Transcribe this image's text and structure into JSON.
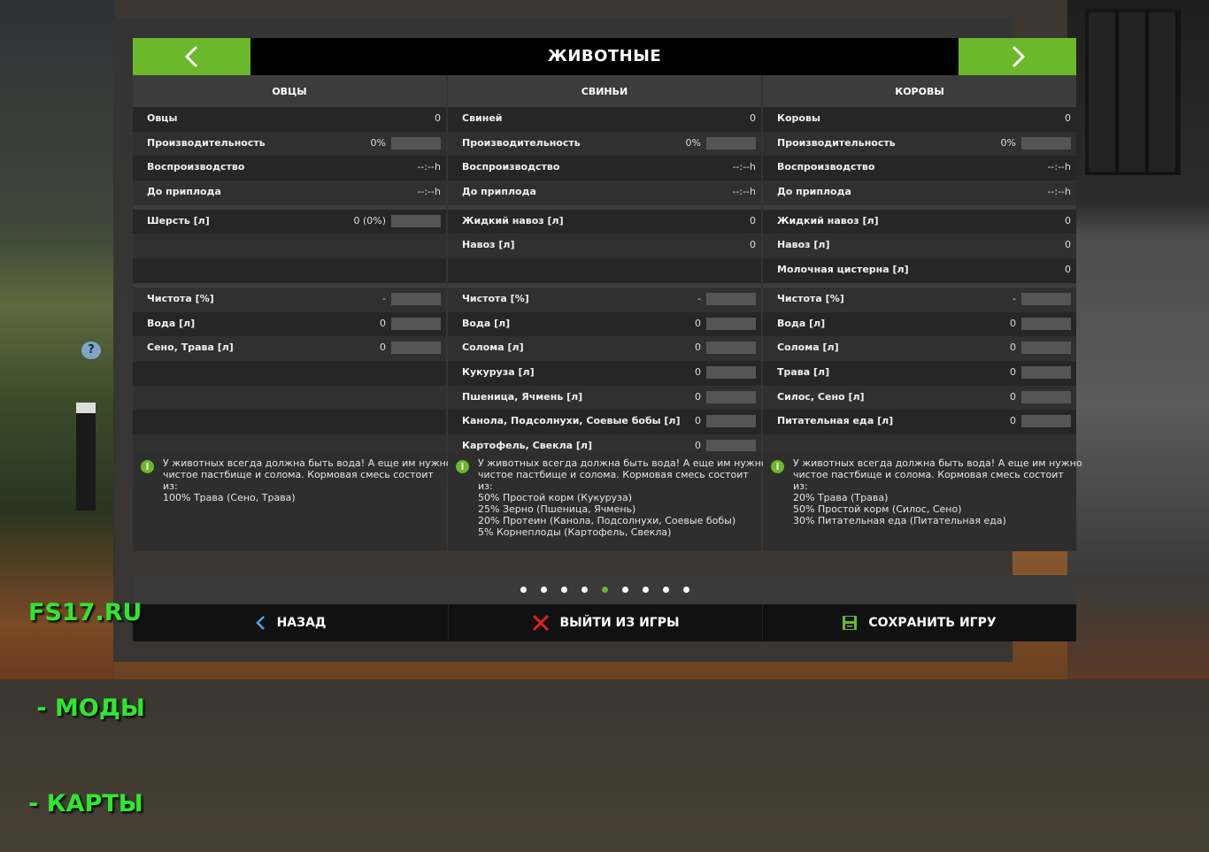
{
  "header": {
    "title": "ЖИВОТНЫЕ"
  },
  "columns": [
    {
      "title": "ОВЦЫ",
      "rows": [
        {
          "label": "Овцы",
          "value": "0",
          "bar": false
        },
        {
          "label": "Производительность",
          "value": "0%",
          "bar": true,
          "fill": 0
        },
        {
          "label": "Воспроизводство",
          "value": "--:--h",
          "bar": false
        },
        {
          "label": "До приплода",
          "value": "--:--h",
          "bar": false
        }
      ],
      "products": [
        {
          "label": "Шерсть [л]",
          "value": "0 (0%)",
          "bar": true,
          "fill": 0
        },
        {
          "label": "",
          "value": "",
          "bar": false
        },
        {
          "label": "",
          "value": "",
          "bar": false
        }
      ],
      "needs": [
        {
          "label": "Чистота [%]",
          "value": "-",
          "bar": true,
          "fill": 0
        },
        {
          "label": "Вода [л]",
          "value": "0",
          "bar": true,
          "fill": 0
        },
        {
          "label": "Сено, Трава [л]",
          "value": "0",
          "bar": true,
          "fill": 0
        },
        {
          "label": "",
          "value": "",
          "bar": false
        },
        {
          "label": "",
          "value": "",
          "bar": false
        },
        {
          "label": "",
          "value": "",
          "bar": false
        },
        {
          "label": "",
          "value": "",
          "bar": false
        }
      ],
      "info": {
        "intro": [
          "У животных всегда должна быть вода! А еще им нужно",
          "чистое пастбище и солома. Кормовая смесь состоит",
          "из:"
        ],
        "mix": [
          "100% Трава (Сено, Трава)"
        ]
      }
    },
    {
      "title": "СВИНЬИ",
      "rows": [
        {
          "label": "Свиней",
          "value": "0",
          "bar": false
        },
        {
          "label": "Производительность",
          "value": "0%",
          "bar": true,
          "fill": 0
        },
        {
          "label": "Воспроизводство",
          "value": "--:--h",
          "bar": false
        },
        {
          "label": "До приплода",
          "value": "--:--h",
          "bar": false
        }
      ],
      "products": [
        {
          "label": "Жидкий навоз [л]",
          "value": "0",
          "bar": false
        },
        {
          "label": "Навоз [л]",
          "value": "0",
          "bar": false
        },
        {
          "label": "",
          "value": "",
          "bar": false
        }
      ],
      "needs": [
        {
          "label": "Чистота [%]",
          "value": "-",
          "bar": true,
          "fill": 0
        },
        {
          "label": "Вода [л]",
          "value": "0",
          "bar": true,
          "fill": 0
        },
        {
          "label": "Солома [л]",
          "value": "0",
          "bar": true,
          "fill": 0
        },
        {
          "label": "Кукуруза [л]",
          "value": "0",
          "bar": true,
          "fill": 0
        },
        {
          "label": "Пшеница, Ячмень [л]",
          "value": "0",
          "bar": true,
          "fill": 0
        },
        {
          "label": "Канола, Подсолнухи, Соевые бобы [л]",
          "value": "0",
          "bar": true,
          "fill": 0
        },
        {
          "label": "Картофель, Свекла [л]",
          "value": "0",
          "bar": true,
          "fill": 0
        }
      ],
      "info": {
        "intro": [
          "У животных всегда должна быть вода! А еще им нужно",
          "чистое пастбище и солома. Кормовая смесь состоит",
          "из:"
        ],
        "mix": [
          "50% Простой корм (Кукуруза)",
          "25% Зерно (Пшеница, Ячмень)",
          "20% Протеин (Канола, Подсолнухи, Соевые бобы)",
          "5% Корнеплоды (Картофель, Свекла)"
        ]
      }
    },
    {
      "title": "КОРОВЫ",
      "rows": [
        {
          "label": "Коровы",
          "value": "0",
          "bar": false
        },
        {
          "label": "Производительность",
          "value": "0%",
          "bar": true,
          "fill": 0
        },
        {
          "label": "Воспроизводство",
          "value": "--:--h",
          "bar": false
        },
        {
          "label": "До приплода",
          "value": "--:--h",
          "bar": false
        }
      ],
      "products": [
        {
          "label": "Жидкий навоз [л]",
          "value": "0",
          "bar": false
        },
        {
          "label": "Навоз [л]",
          "value": "0",
          "bar": false
        },
        {
          "label": "Молочная цистерна [л]",
          "value": "0",
          "bar": false
        }
      ],
      "needs": [
        {
          "label": "Чистота [%]",
          "value": "-",
          "bar": true,
          "fill": 0
        },
        {
          "label": "Вода [л]",
          "value": "0",
          "bar": true,
          "fill": 0
        },
        {
          "label": "Солома [л]",
          "value": "0",
          "bar": true,
          "fill": 0
        },
        {
          "label": "Трава [л]",
          "value": "0",
          "bar": true,
          "fill": 0
        },
        {
          "label": "Силос, Сено [л]",
          "value": "0",
          "bar": true,
          "fill": 0
        },
        {
          "label": "Питательная еда [л]",
          "value": "0",
          "bar": true,
          "fill": 0
        },
        {
          "label": "",
          "value": "",
          "bar": false
        }
      ],
      "info": {
        "intro": [
          "У животных всегда должна быть вода! А еще им нужно",
          "чистое пастбище и солома. Кормовая смесь состоит",
          "из:"
        ],
        "mix": [
          "20% Трава (Трава)",
          "50% Простой корм (Силос, Сено)",
          "30% Питательная еда (Питательная еда)"
        ]
      }
    }
  ],
  "pager": {
    "count": 9,
    "active_index": 4
  },
  "footer": {
    "back_label": "НАЗАД",
    "quit_label": "ВЫЙТИ ИЗ ИГРЫ",
    "save_label": "СОХРАНИТЬ ИГРУ"
  },
  "watermark": {
    "lines": [
      "FS17.RU",
      " - МОДЫ",
      "- КАРТЫ"
    ]
  },
  "colors": {
    "accent": "#6bb82a",
    "watermark": "#2ee82e",
    "quit_icon": "#e02020",
    "back_icon": "#4aa8e8",
    "save_icon": "#6bb82a"
  },
  "icons": {
    "prev": "chevron-left-icon",
    "next": "chevron-right-icon",
    "info": "info-icon",
    "back": "chevron-left-icon",
    "quit": "close-icon",
    "save": "floppy-disk-icon",
    "help": "help-icon"
  }
}
